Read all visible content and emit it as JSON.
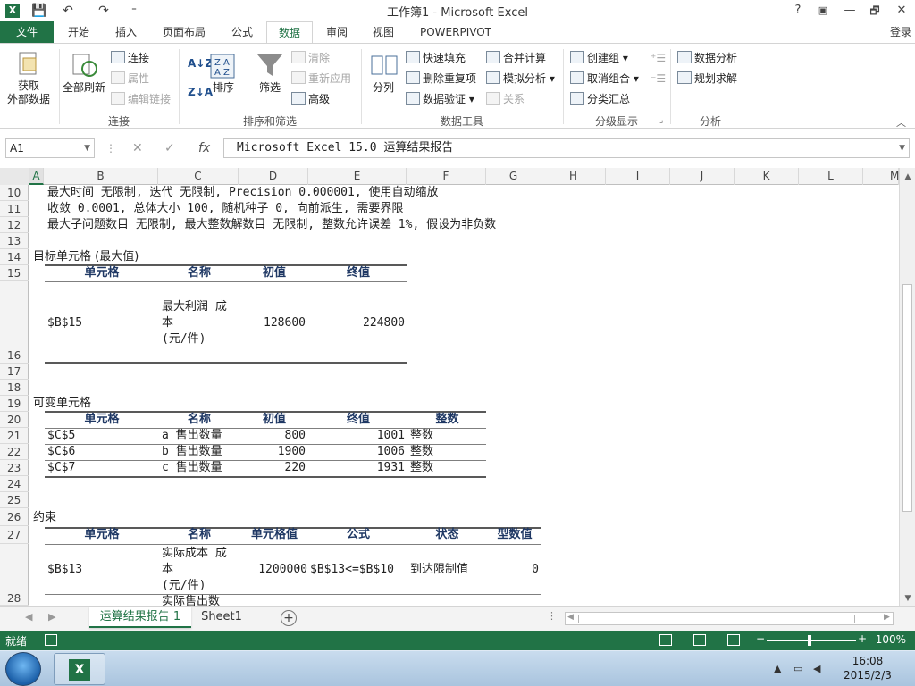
{
  "window": {
    "title": "工作簿1 - Microsoft Excel",
    "help": "?",
    "min": "—",
    "restore": "🗗",
    "close": "✕"
  },
  "quick_access": {
    "save": "💾",
    "undo": "↶",
    "redo": "↷",
    "customize": "⁼"
  },
  "ribbon_tabs": [
    "文件",
    "开始",
    "插入",
    "页面布局",
    "公式",
    "数据",
    "审阅",
    "视图",
    "POWERPIVOT"
  ],
  "active_tab": "数据",
  "login": "登录",
  "ribbon": {
    "get_external": [
      "获取",
      "外部数据"
    ],
    "refresh_all": "全部刷新",
    "connections": "连接",
    "properties": "属性",
    "edit_links": "编辑链接",
    "group_connections": "连接",
    "sort": "排序",
    "filter": "筛选",
    "clear": "清除",
    "reapply": "重新应用",
    "advanced": "高级",
    "group_sort_filter": "排序和筛选",
    "text_to_columns": "分列",
    "flash_fill": "快速填充",
    "remove_duplicates": "删除重复项",
    "data_validation": "数据验证",
    "consolidate": "合并计算",
    "what_if": "模拟分析",
    "relationships": "关系",
    "group_data_tools": "数据工具",
    "group": "创建组",
    "ungroup": "取消组合",
    "subtotal": "分类汇总",
    "group_outline": "分级显示",
    "data_analysis": "数据分析",
    "solver": "规划求解",
    "group_analysis": "分析"
  },
  "formula_bar": {
    "name_box": "A1",
    "cancel": "✕",
    "enter": "✓",
    "fx": "fx",
    "content": "Microsoft Excel 15.0 运算结果报告"
  },
  "columns": [
    "A",
    "B",
    "C",
    "D",
    "E",
    "F",
    "G",
    "H",
    "I",
    "J",
    "K",
    "L",
    "M"
  ],
  "rows": [
    "10",
    "11",
    "12",
    "13",
    "14",
    "15",
    "16",
    "17",
    "18",
    "19",
    "20",
    "21",
    "22",
    "23",
    "24",
    "25",
    "26",
    "27",
    "28"
  ],
  "sheet": {
    "r10": "最大时间 无限制, 迭代 无限制, Precision 0.000001, 使用自动缩放",
    "r11": " 收敛 0.0001, 总体大小 100, 随机种子 0, 向前派生, 需要界限",
    "r12": "最大子问题数目 无限制, 最大整数解数目 无限制, 整数允许误差 1%, 假设为非负数",
    "objective_title": "目标单元格 (最大值)",
    "obj_headers": [
      "单元格",
      "名称",
      "初值",
      "终值"
    ],
    "obj_row": {
      "cell": "$B$15",
      "name": [
        "最大利润 成",
        "本",
        "(元/件)"
      ],
      "initial": "128600",
      "final": "224800"
    },
    "variable_title": "可变单元格",
    "var_headers": [
      "单元格",
      "名称",
      "初值",
      "终值",
      "整数"
    ],
    "var_rows": [
      {
        "cell": "$C$5",
        "name": "a 售出数量",
        "initial": "800",
        "final": "1001",
        "int": "整数"
      },
      {
        "cell": "$C$6",
        "name": "b 售出数量",
        "initial": "1900",
        "final": "1006",
        "int": "整数"
      },
      {
        "cell": "$C$7",
        "name": "c 售出数量",
        "initial": "220",
        "final": "1931",
        "int": "整数"
      }
    ],
    "constraint_title": "约束",
    "con_headers": [
      "单元格",
      "名称",
      "单元格值",
      "公式",
      "状态",
      "型数值"
    ],
    "con_row": {
      "cell": "$B$13",
      "name": [
        "实际成本 成",
        "本",
        "(元/件)"
      ],
      "value": "1200000",
      "formula": "$B$13<=$B$10",
      "status": "到达限制值",
      "slack": "0"
    },
    "con_next_name": "实际售出数"
  },
  "sheet_tabs": [
    "运算结果报告 1",
    "Sheet1"
  ],
  "status": {
    "ready": "就绪",
    "zoom": "100%"
  },
  "taskbar": {
    "time": "16:08",
    "date": "2015/2/3"
  }
}
